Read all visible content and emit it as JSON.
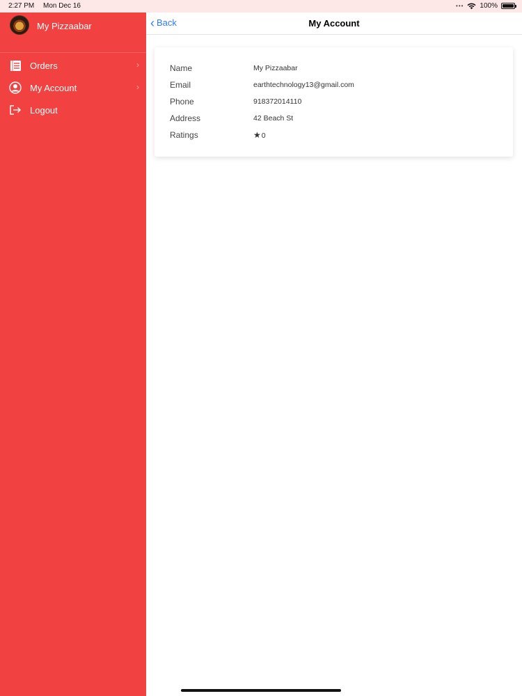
{
  "status_bar": {
    "time": "2:27 PM",
    "date": "Mon Dec 16",
    "battery": "100%"
  },
  "sidebar": {
    "brand": "My Pizzaabar",
    "items": [
      {
        "label": "Orders",
        "icon": "list-icon",
        "has_chevron": true
      },
      {
        "label": "My Account",
        "icon": "user-icon",
        "has_chevron": true
      },
      {
        "label": "Logout",
        "icon": "logout-icon",
        "has_chevron": false
      }
    ]
  },
  "navbar": {
    "back_label": "Back",
    "title": "My Account"
  },
  "account": {
    "fields": [
      {
        "label": "Name",
        "value": "My Pizzaabar"
      },
      {
        "label": "Email",
        "value": "earthtechnology13@gmail.com"
      },
      {
        "label": "Phone",
        "value": "918372014110"
      },
      {
        "label": "Address",
        "value": "42 Beach St"
      },
      {
        "label": "Ratings",
        "value": "0"
      }
    ]
  },
  "colors": {
    "sidebar_bg": "#f24141",
    "accent": "#2f7cf6",
    "status_bg": "#fde7e7"
  }
}
